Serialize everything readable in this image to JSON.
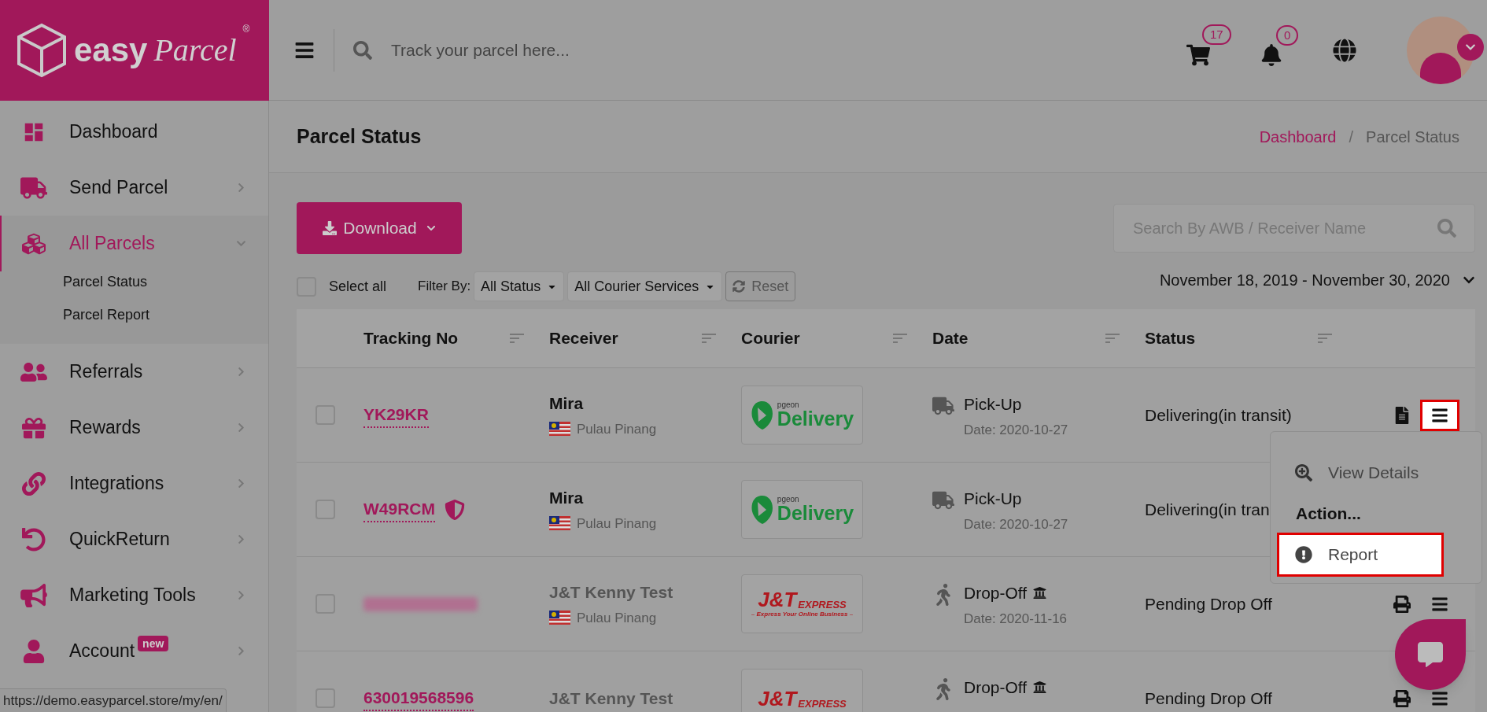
{
  "header": {
    "logo": {
      "word1": "easy",
      "word2": "Parcel",
      "mark": "®"
    },
    "search": {
      "placeholder": "Track your parcel here..."
    },
    "cart_count": "17",
    "notification_count": "0"
  },
  "sidebar": {
    "items": [
      {
        "kind": "link",
        "label": "Dashboard",
        "selected": false
      },
      {
        "kind": "menu",
        "label": "Send Parcel",
        "selected": false,
        "expanded": false
      },
      {
        "kind": "menu",
        "label": "All Parcels",
        "selected": true,
        "expanded": true,
        "children": [
          {
            "label": "Parcel Status"
          },
          {
            "label": "Parcel Report"
          }
        ]
      },
      {
        "kind": "menu",
        "label": "Referrals",
        "selected": false,
        "expanded": false
      },
      {
        "kind": "menu",
        "label": "Rewards",
        "selected": false,
        "expanded": false
      },
      {
        "kind": "menu",
        "label": "Integrations",
        "selected": false,
        "expanded": false
      },
      {
        "kind": "menu",
        "label": "QuickReturn",
        "selected": false,
        "expanded": false
      },
      {
        "kind": "menu",
        "label": "Marketing Tools",
        "selected": false,
        "expanded": false
      },
      {
        "kind": "menu",
        "label": "Account",
        "badge": "new",
        "selected": false,
        "expanded": false
      }
    ]
  },
  "page": {
    "title": "Parcel Status",
    "breadcrumb_separator": "/",
    "breadcrumb": [
      {
        "label": "Dashboard",
        "link": true
      },
      {
        "label": "Parcel Status",
        "link": false
      }
    ]
  },
  "toolbar": {
    "download": "Download",
    "search_placeholder": "Search By AWB / Receiver Name",
    "select_all": {
      "label": "Select all",
      "checked": false
    },
    "filter_label": "Filter By:",
    "filters": [
      "All Status",
      "All Courier Services"
    ],
    "reset": "Reset",
    "date_range": "November 18, 2019 - November 30, 2020"
  },
  "table": {
    "columns": [
      "Tracking No",
      "Receiver",
      "Courier",
      "Date",
      "Status"
    ],
    "rows": [
      {
        "checked": false,
        "tracking": "YK29KR",
        "verified": false,
        "receiver": "Mira",
        "region": "Pulau Pinang",
        "courier": {
          "kind": "pgeon",
          "texts": [
            "pgeon",
            "Delivery"
          ]
        },
        "method": {
          "kind": "pickup",
          "label": "Pick-Up",
          "branch": false,
          "date": "Date: 2020-10-27"
        },
        "status": "Delivering(in transit)",
        "kind": "document",
        "highlighted": true
      },
      {
        "checked": false,
        "tracking": "W49RCM",
        "verified": true,
        "receiver": "Mira",
        "region": "Pulau Pinang",
        "courier": {
          "kind": "pgeon",
          "texts": [
            "pgeon",
            "Delivery"
          ]
        },
        "method": {
          "kind": "pickup",
          "label": "Pick-Up",
          "branch": false,
          "date": "Date: 2020-10-27"
        },
        "status": "Delivering(in tran"
      },
      {
        "checked": false,
        "verified": false,
        "receiver": "J&T Kenny Test",
        "region": "Pulau Pinang",
        "courier": {
          "kind": "jnt",
          "texts": [
            "J&T",
            "EXPRESS",
            "– Express Your Online Business –"
          ]
        },
        "method": {
          "kind": "dropoff",
          "label": "Drop-Off",
          "branch": true,
          "date": "Date: 2020-11-16"
        },
        "status": "Pending Drop Off",
        "kind": "printer",
        "highlighted": false
      },
      {
        "checked": false,
        "tracking": "630019568596",
        "verified": false,
        "receiver": "J&T Kenny Test",
        "courier": {
          "kind": "jnt",
          "texts": [
            "J&T",
            "EXPRESS"
          ]
        },
        "method": {
          "kind": "dropoff",
          "label": "Drop-Off",
          "branch": true
        },
        "status": "Pending Drop Off",
        "kind": "printer",
        "highlighted": false
      }
    ]
  },
  "menu": {
    "items": [
      {
        "kind": "item",
        "label": "View Details",
        "highlighted": false
      },
      {
        "kind": "heading",
        "label": "Action..."
      },
      {
        "kind": "item",
        "label": "Report",
        "highlighted": true
      }
    ]
  },
  "status_url": "https://demo.easyparcel.store/my/en/"
}
